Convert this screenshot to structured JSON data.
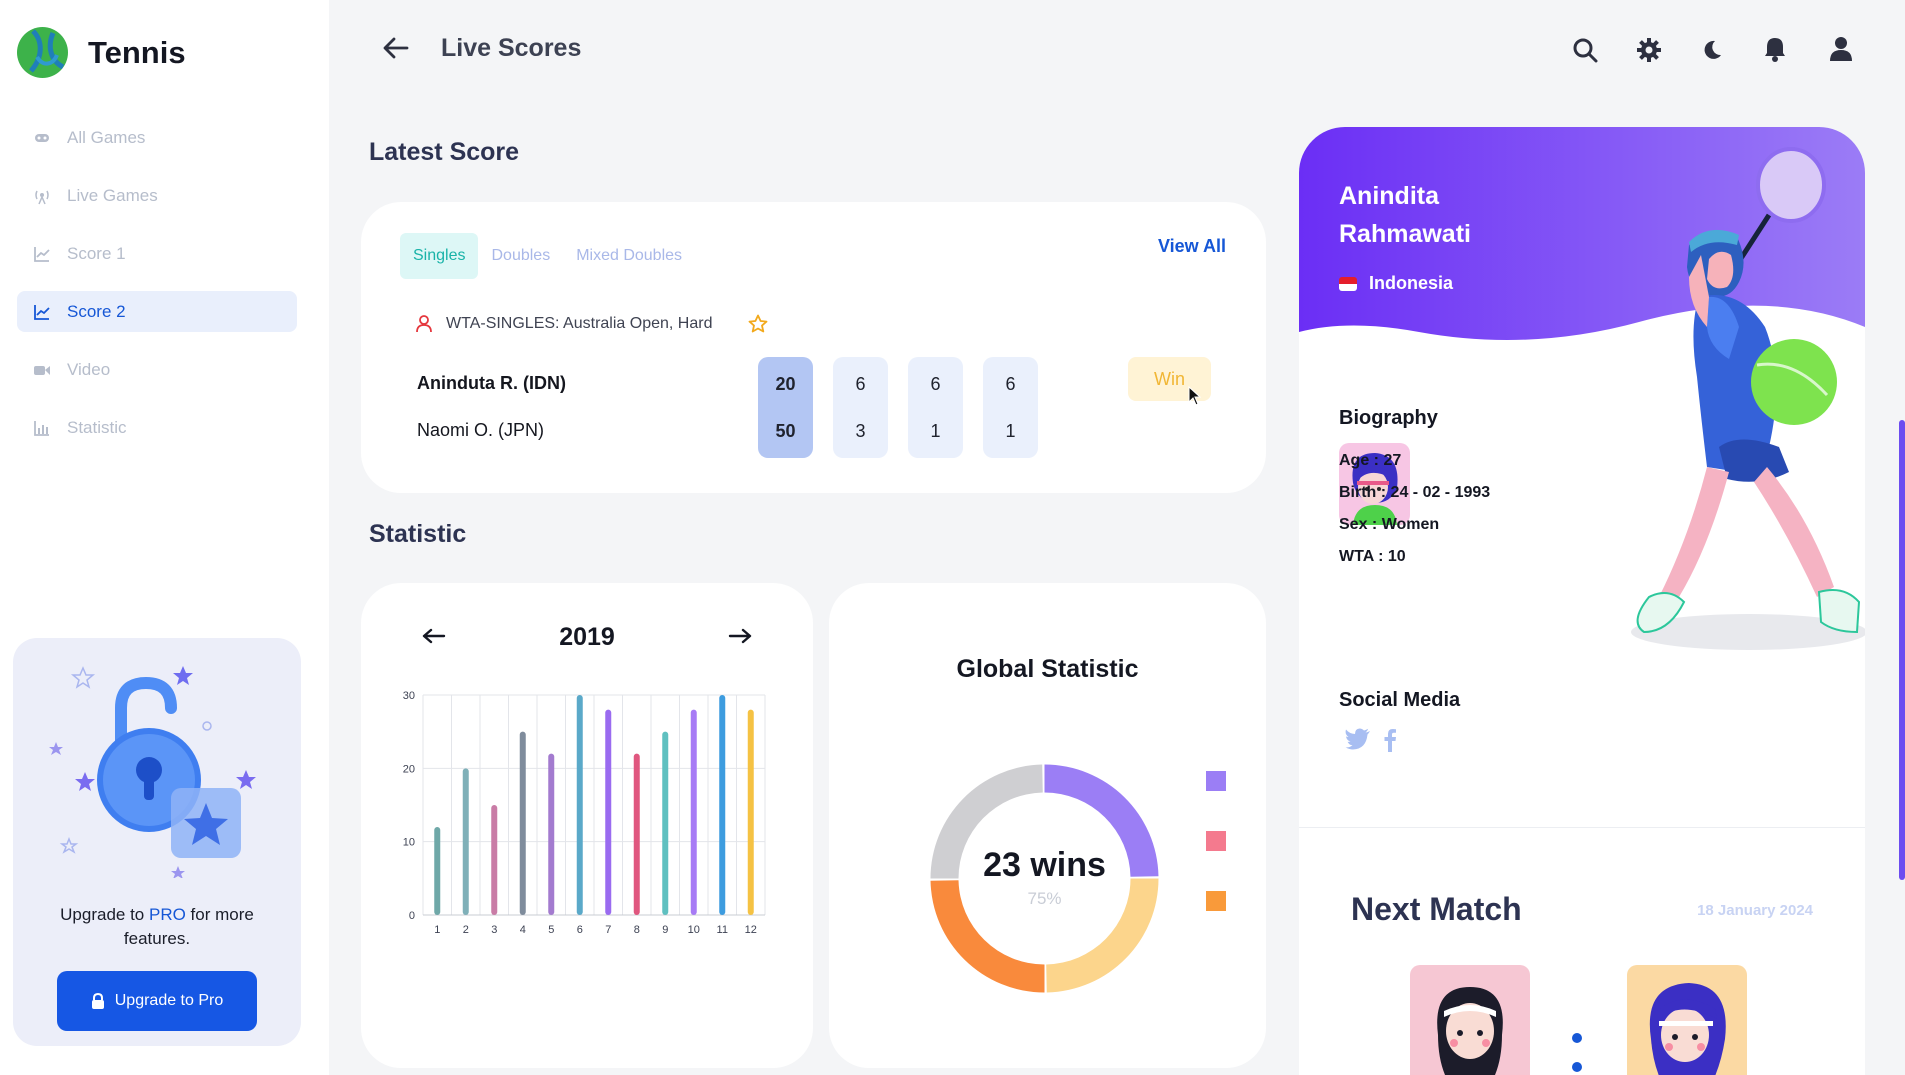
{
  "brand": {
    "name": "Tennis"
  },
  "sidebar": {
    "items": [
      {
        "label": "All Games",
        "icon": "gamepad-icon"
      },
      {
        "label": "Live Games",
        "icon": "broadcast-icon"
      },
      {
        "label": "Score 1",
        "icon": "line-chart-icon"
      },
      {
        "label": "Score 2",
        "icon": "line-chart-icon"
      },
      {
        "label": "Video",
        "icon": "video-icon"
      },
      {
        "label": "Statistic",
        "icon": "bar-chart-icon"
      }
    ],
    "active_index": 3
  },
  "upgrade": {
    "text_before": "Upgrade to ",
    "text_pro": "PRO",
    "text_after": " for more features.",
    "button_label": "Upgrade to Pro"
  },
  "header": {
    "title": "Live Scores"
  },
  "latest": {
    "title": "Latest Score",
    "tabs": [
      "Singles",
      "Doubles",
      "Mixed Doubles"
    ],
    "active_tab": 0,
    "view_all": "View All",
    "tournament": "WTA-SINGLES: Australia Open, Hard",
    "players": [
      "Aninduta R. (IDN)",
      "Naomi O. (JPN)"
    ],
    "sets": [
      {
        "p1": "20",
        "p2": "50"
      },
      {
        "p1": "6",
        "p2": "3"
      },
      {
        "p1": "6",
        "p2": "1"
      },
      {
        "p1": "6",
        "p2": "1"
      }
    ],
    "result": "Win"
  },
  "statistic": {
    "title": "Statistic",
    "year": "2019"
  },
  "chart_data": [
    {
      "type": "bar",
      "categories": [
        "1",
        "2",
        "3",
        "4",
        "5",
        "6",
        "7",
        "8",
        "9",
        "10",
        "11",
        "12"
      ],
      "values": [
        12,
        20,
        15,
        25,
        22,
        30,
        28,
        22,
        25,
        28,
        30,
        28
      ],
      "colors": [
        "#6fa8a8",
        "#7fb0b8",
        "#c97ca6",
        "#7f8c9c",
        "#a37bcf",
        "#5aa9c9",
        "#9a6bf0",
        "#e0577f",
        "#5fc0c0",
        "#a77bf5",
        "#3d9cdf",
        "#f5c243"
      ],
      "yticks": [
        0,
        10,
        20,
        30
      ],
      "ylim": [
        0,
        30
      ],
      "grid": true
    },
    {
      "type": "pie",
      "title": "Global Statistic",
      "center_label": "23 wins",
      "center_sublabel": "75%",
      "segments": [
        {
          "value": 25,
          "color": "#9b7ef5"
        },
        {
          "value": 25,
          "color": "#fcd58c"
        },
        {
          "value": 25,
          "color": "#f98a3c"
        },
        {
          "value": 25,
          "color": "#cfcfd2"
        }
      ],
      "legend_colors": [
        "#9b7ef5",
        "#f47a8e",
        "#f99a3a"
      ]
    }
  ],
  "profile": {
    "first_name": "Anindita",
    "last_name": "Rahmawati",
    "country": "Indonesia",
    "bio_title": "Biography",
    "age": "Age : 27",
    "birth": "Birth : 24 - 02 - 1993",
    "sex": "Sex : Women",
    "wta": "WTA : 10",
    "social_title": "Social Media",
    "accent": "#6f3cf5"
  },
  "next_match": {
    "title": "Next Match",
    "date": "18 January 2024"
  }
}
